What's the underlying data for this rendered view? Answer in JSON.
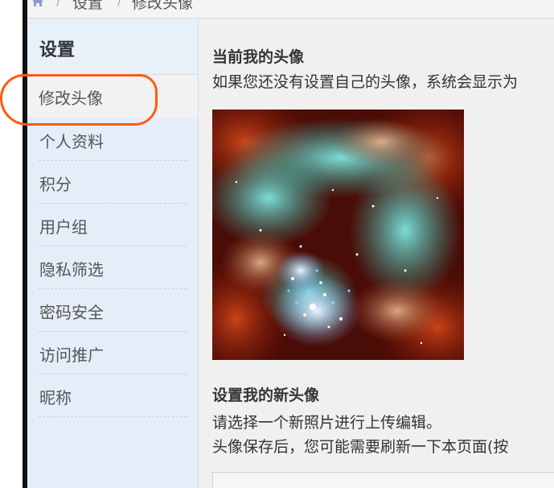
{
  "breadcrumb": {
    "home_icon": "home-icon",
    "items": [
      "设置",
      "修改头像"
    ]
  },
  "sidebar": {
    "title": "设置",
    "active_item": "修改头像",
    "items": [
      "个人资料",
      "积分",
      "用户组",
      "隐私筛选",
      "密码安全",
      "访问推广",
      "昵称"
    ]
  },
  "main": {
    "current_avatar": {
      "heading": "当前我的头像",
      "description": "如果您还没有设置自己的头像，系统会显示为"
    },
    "new_avatar": {
      "heading": "设置我的新头像",
      "line1": "请选择一个新照片进行上传编辑。",
      "line2": "头像保存后，您可能需要刷新一下本页面(按"
    }
  },
  "colors": {
    "sidebar_bg": "#e5eef8",
    "highlight_annotation": "#ff5a14",
    "page_bg": "#f0f0f0"
  }
}
